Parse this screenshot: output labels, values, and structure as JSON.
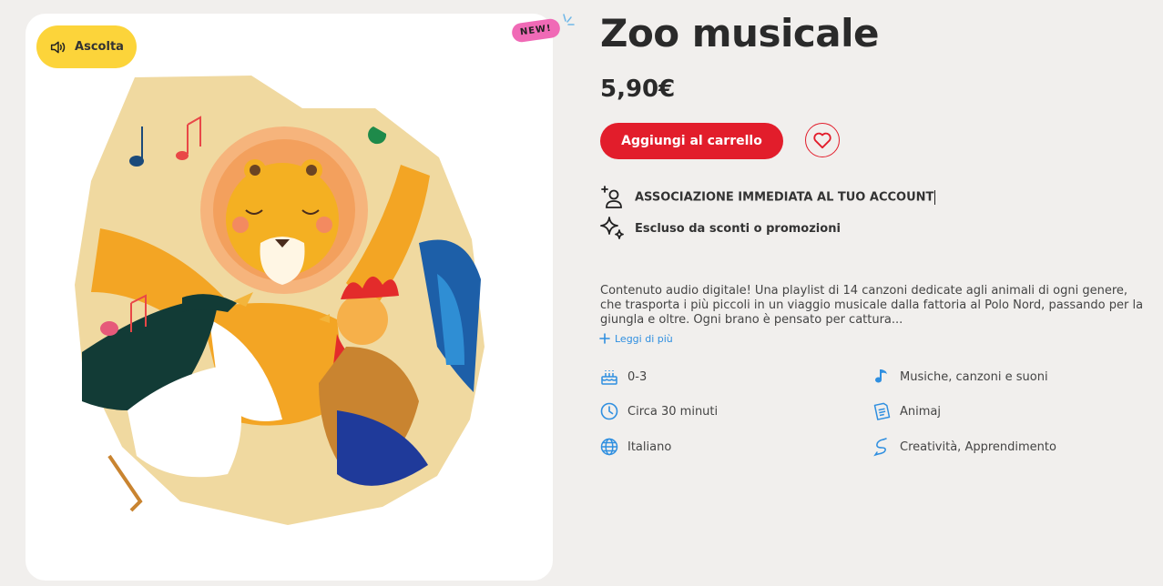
{
  "player": {
    "listen_label": "Ascolta",
    "badge": "NEW!"
  },
  "product": {
    "title": "Zoo musicale",
    "price": "5,90€",
    "cart_label": "Aggiungi al carrello",
    "features": [
      {
        "icon": "user-plus-icon",
        "label": "ASSOCIAZIONE IMMEDIATA AL TUO ACCOUNT"
      },
      {
        "icon": "sparkles-icon",
        "label": "Escluso da sconti o promozioni"
      }
    ],
    "description": "Contenuto audio digitale! Una playlist di 14 canzoni dedicate agli animali di ogni genere, che trasporta i più piccoli in un viaggio musicale dalla fattoria al Polo Nord, passando per la giungla e oltre. Ogni brano è pensato per cattura...",
    "read_more": "Leggi di più",
    "details": [
      {
        "icon": "cake-icon",
        "label": "0-3"
      },
      {
        "icon": "music-note-icon",
        "label": "Musiche, canzoni e suoni"
      },
      {
        "icon": "clock-icon",
        "label": "Circa 30 minuti"
      },
      {
        "icon": "book-icon",
        "label": "Animaj"
      },
      {
        "icon": "globe-icon",
        "label": "Italiano"
      },
      {
        "icon": "creativity-icon",
        "label": "Creatività, Apprendimento"
      }
    ]
  },
  "colors": {
    "accent": "#e21d2b",
    "link": "#2f8fe0",
    "listen_bg": "#fcd43a",
    "badge_bg": "#f06ab6"
  }
}
